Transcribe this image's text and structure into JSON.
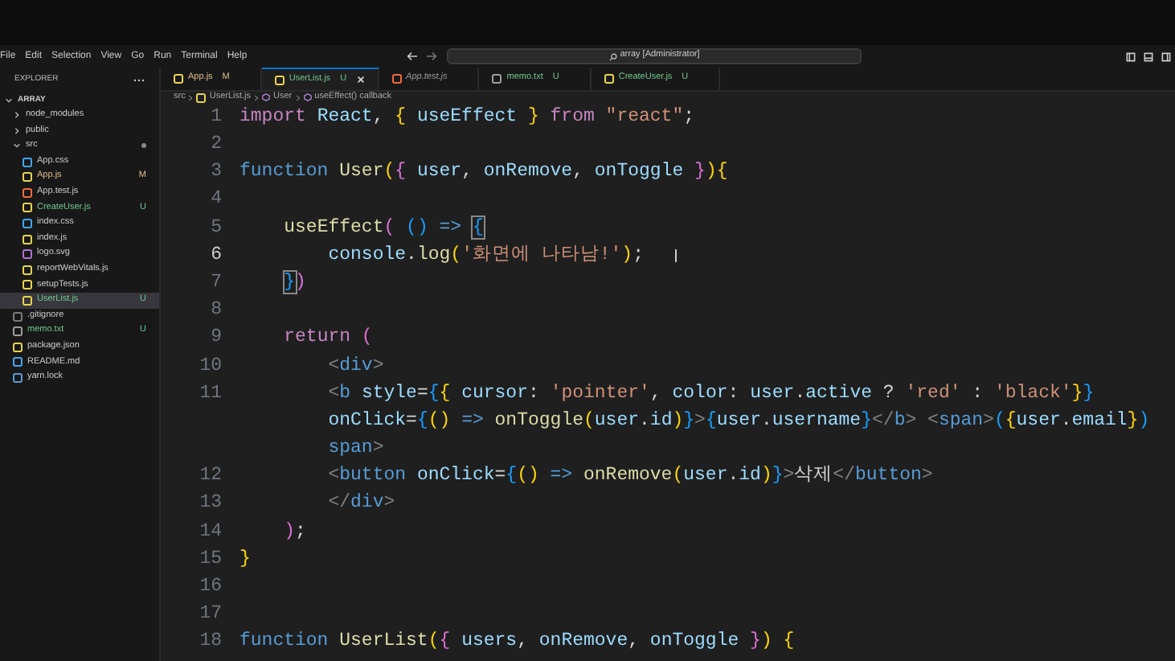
{
  "menu": [
    "File",
    "Edit",
    "Selection",
    "View",
    "Go",
    "Run",
    "Terminal",
    "Help"
  ],
  "command_center": {
    "value": "array [Administrator]"
  },
  "explorer": {
    "title": "EXPLORER",
    "root": {
      "name": "ARRAY",
      "expanded": true,
      "children": [
        {
          "name": "node_modules",
          "kind": "folder",
          "expanded": false,
          "selected": false
        },
        {
          "name": "public",
          "kind": "folder",
          "expanded": false,
          "selected": false
        },
        {
          "name": "src",
          "kind": "folder",
          "expanded": true,
          "selected": false,
          "changes_dot": true,
          "children": [
            {
              "name": "App.css",
              "kind": "css",
              "selected": false
            },
            {
              "name": "App.js",
              "kind": "js",
              "color": "#e2c08d",
              "status": "M",
              "selected": false
            },
            {
              "name": "App.test.js",
              "kind": "test",
              "selected": false
            },
            {
              "name": "CreateUser.js",
              "kind": "js",
              "color": "#73c991",
              "status": "U",
              "selected": false
            },
            {
              "name": "index.css",
              "kind": "css",
              "selected": false
            },
            {
              "name": "index.js",
              "kind": "js",
              "selected": false
            },
            {
              "name": "logo.svg",
              "kind": "svg",
              "selected": false
            },
            {
              "name": "reportWebVitals.js",
              "kind": "js",
              "selected": false
            },
            {
              "name": "setupTests.js",
              "kind": "js",
              "selected": false
            },
            {
              "name": "UserList.js",
              "kind": "js",
              "color": "#73c991",
              "status": "U",
              "selected": true
            }
          ]
        },
        {
          "name": ".gitignore",
          "kind": "git",
          "selected": false
        },
        {
          "name": "memo.txt",
          "kind": "txt",
          "color": "#73c991",
          "status": "U",
          "selected": false
        },
        {
          "name": "package.json",
          "kind": "json",
          "selected": false
        },
        {
          "name": "README.md",
          "kind": "md",
          "selected": false
        },
        {
          "name": "yarn.lock",
          "kind": "yarn",
          "selected": false
        }
      ]
    }
  },
  "tabs": [
    {
      "name": "App.js",
      "kind": "js",
      "color": "#e2c08d",
      "status": "M",
      "selected": false,
      "preview": false
    },
    {
      "name": "UserList.js",
      "kind": "js",
      "color": "#73c991",
      "status": "U",
      "selected": true,
      "preview": false
    },
    {
      "name": "App.test.js",
      "kind": "test",
      "selected": false,
      "preview": true
    },
    {
      "name": "memo.txt",
      "kind": "txt",
      "color": "#73c991",
      "status": "U",
      "selected": false,
      "preview": false
    },
    {
      "name": "CreateUser.js",
      "kind": "js",
      "color": "#73c991",
      "status": "U",
      "selected": false,
      "preview": false
    }
  ],
  "breadcrumb": [
    {
      "text": "src",
      "kind": "folder"
    },
    {
      "text": "UserList.js",
      "kind": "js"
    },
    {
      "text": "User",
      "kind": "symbol"
    },
    {
      "text": "useEffect() callback",
      "kind": "symbol"
    }
  ],
  "editor": {
    "lines": [
      {
        "number": "1",
        "current": false,
        "tokens": [
          {
            "kind": "kw",
            "text": "import "
          },
          {
            "kind": "var",
            "text": "React"
          },
          {
            "kind": "p",
            "text": ", "
          },
          {
            "kind": "b1",
            "text": "{ "
          },
          {
            "kind": "var",
            "text": "useEffect "
          },
          {
            "kind": "b1",
            "text": "} "
          },
          {
            "kind": "kw",
            "text": "from "
          },
          {
            "kind": "str",
            "text": "\"react\""
          },
          {
            "kind": "p",
            "text": ";"
          }
        ]
      },
      {
        "number": "2",
        "current": false
      },
      {
        "number": "3",
        "current": false,
        "tokens": [
          {
            "kind": "st",
            "text": "function "
          },
          {
            "kind": "fn",
            "text": "User"
          },
          {
            "kind": "b1",
            "text": "("
          },
          {
            "kind": "b2",
            "text": "{ "
          },
          {
            "kind": "var",
            "text": "user"
          },
          {
            "kind": "p",
            "text": ", "
          },
          {
            "kind": "var",
            "text": "onRemove"
          },
          {
            "kind": "p",
            "text": ", "
          },
          {
            "kind": "var",
            "text": "onToggle "
          },
          {
            "kind": "b2",
            "text": "}"
          },
          {
            "kind": "b1",
            "text": ")"
          },
          {
            "kind": "b1",
            "text": "{"
          }
        ]
      },
      {
        "number": "4",
        "current": false
      },
      {
        "number": "5",
        "current": false,
        "tokens": [
          {
            "kind": "fn",
            "text": "    useEffect"
          },
          {
            "kind": "b2",
            "text": "( "
          },
          {
            "kind": "b3",
            "text": "() "
          },
          {
            "kind": "st",
            "text": "=> "
          },
          {
            "kind": "b3m",
            "text": "{"
          }
        ]
      },
      {
        "number": "6",
        "current": true,
        "tokens": [
          {
            "kind": "var",
            "text": "        console"
          },
          {
            "kind": "p",
            "text": "."
          },
          {
            "kind": "fn",
            "text": "log"
          },
          {
            "kind": "b1",
            "text": "("
          },
          {
            "kind": "str",
            "text": "'화면에 나타남!'"
          },
          {
            "kind": "b1",
            "text": ")"
          },
          {
            "kind": "p",
            "text": ";"
          }
        ]
      },
      {
        "number": "7",
        "current": false,
        "tokens": [
          {
            "kind": "b3m",
            "text": "    }"
          },
          {
            "kind": "b2",
            "text": ")"
          }
        ]
      },
      {
        "number": "8",
        "current": false
      },
      {
        "number": "9",
        "current": false,
        "tokens": [
          {
            "kind": "kw",
            "text": "    return "
          },
          {
            "kind": "b2",
            "text": "("
          }
        ]
      },
      {
        "number": "10",
        "current": false,
        "tokens": [
          {
            "kind": "tag",
            "text": "        <"
          },
          {
            "kind": "st",
            "text": "div"
          },
          {
            "kind": "tag",
            "text": ">"
          }
        ]
      },
      {
        "number": "11",
        "current": false,
        "tokens": [
          {
            "kind": "tag",
            "text": "        <"
          },
          {
            "kind": "st",
            "text": "b "
          },
          {
            "kind": "var",
            "text": "style"
          },
          {
            "kind": "p",
            "text": "="
          },
          {
            "kind": "b3",
            "text": "{"
          },
          {
            "kind": "b1",
            "text": "{ "
          },
          {
            "kind": "var",
            "text": "cursor"
          },
          {
            "kind": "p",
            "text": ": "
          },
          {
            "kind": "str",
            "text": "'pointer'"
          },
          {
            "kind": "p",
            "text": ", "
          },
          {
            "kind": "var",
            "text": "color"
          },
          {
            "kind": "p",
            "text": ": "
          },
          {
            "kind": "var",
            "text": "user"
          },
          {
            "kind": "p",
            "text": "."
          },
          {
            "kind": "var",
            "text": "active"
          },
          {
            "kind": "p",
            "text": " ? "
          },
          {
            "kind": "str",
            "text": "'red'"
          },
          {
            "kind": "p",
            "text": " : "
          },
          {
            "kind": "str",
            "text": "'black'"
          },
          {
            "kind": "b1",
            "text": "}"
          },
          {
            "kind": "b3",
            "text": "}"
          }
        ]
      },
      {
        "current": false,
        "tokens": [
          {
            "kind": "var",
            "text": "        onClick"
          },
          {
            "kind": "p",
            "text": "="
          },
          {
            "kind": "b3",
            "text": "{"
          },
          {
            "kind": "b1",
            "text": "() "
          },
          {
            "kind": "st",
            "text": "=> "
          },
          {
            "kind": "fn",
            "text": "onToggle"
          },
          {
            "kind": "b1",
            "text": "("
          },
          {
            "kind": "var",
            "text": "user"
          },
          {
            "kind": "p",
            "text": "."
          },
          {
            "kind": "var",
            "text": "id"
          },
          {
            "kind": "b1",
            "text": ")"
          },
          {
            "kind": "b3",
            "text": "}"
          },
          {
            "kind": "tag",
            "text": ">"
          },
          {
            "kind": "b3",
            "text": "{"
          },
          {
            "kind": "var",
            "text": "user"
          },
          {
            "kind": "p",
            "text": "."
          },
          {
            "kind": "var",
            "text": "username"
          },
          {
            "kind": "b3",
            "text": "}"
          },
          {
            "kind": "tag",
            "text": "</"
          },
          {
            "kind": "st",
            "text": "b"
          },
          {
            "kind": "tag",
            "text": "> <"
          },
          {
            "kind": "st",
            "text": "span"
          },
          {
            "kind": "tag",
            "text": ">"
          },
          {
            "kind": "b3",
            "text": "("
          },
          {
            "kind": "b1",
            "text": "{"
          },
          {
            "kind": "var",
            "text": "user"
          },
          {
            "kind": "p",
            "text": "."
          },
          {
            "kind": "var",
            "text": "email"
          },
          {
            "kind": "b1",
            "text": "}"
          },
          {
            "kind": "b3",
            "text": ")"
          }
        ]
      },
      {
        "current": false,
        "tokens": [
          {
            "kind": "st",
            "text": "        span"
          },
          {
            "kind": "tag",
            "text": ">"
          }
        ]
      },
      {
        "number": "12",
        "current": false,
        "tokens": [
          {
            "kind": "tag",
            "text": "        <"
          },
          {
            "kind": "st",
            "text": "button "
          },
          {
            "kind": "var",
            "text": "onClick"
          },
          {
            "kind": "p",
            "text": "="
          },
          {
            "kind": "b3",
            "text": "{"
          },
          {
            "kind": "b1",
            "text": "() "
          },
          {
            "kind": "st",
            "text": "=> "
          },
          {
            "kind": "fn",
            "text": "onRemove"
          },
          {
            "kind": "b1",
            "text": "("
          },
          {
            "kind": "var",
            "text": "user"
          },
          {
            "kind": "p",
            "text": "."
          },
          {
            "kind": "var",
            "text": "id"
          },
          {
            "kind": "b1",
            "text": ")"
          },
          {
            "kind": "b3",
            "text": "}"
          },
          {
            "kind": "tag",
            "text": ">"
          },
          {
            "kind": "p",
            "text": "삭제"
          },
          {
            "kind": "tag",
            "text": "</"
          },
          {
            "kind": "st",
            "text": "button"
          },
          {
            "kind": "tag",
            "text": ">"
          }
        ]
      },
      {
        "number": "13",
        "current": false,
        "tokens": [
          {
            "kind": "tag",
            "text": "        </"
          },
          {
            "kind": "st",
            "text": "div"
          },
          {
            "kind": "tag",
            "text": ">"
          }
        ]
      },
      {
        "number": "14",
        "current": false,
        "tokens": [
          {
            "kind": "b2",
            "text": "    )"
          },
          {
            "kind": "p",
            "text": ";"
          }
        ]
      },
      {
        "number": "15",
        "current": false,
        "tokens": [
          {
            "kind": "b1",
            "text": "}"
          }
        ]
      },
      {
        "number": "16",
        "current": false
      },
      {
        "number": "17",
        "current": false
      },
      {
        "number": "18",
        "current": false,
        "tokens": [
          {
            "kind": "st",
            "text": "function "
          },
          {
            "kind": "fn",
            "text": "UserList"
          },
          {
            "kind": "b1",
            "text": "("
          },
          {
            "kind": "b2",
            "text": "{ "
          },
          {
            "kind": "var",
            "text": "users"
          },
          {
            "kind": "p",
            "text": ", "
          },
          {
            "kind": "var",
            "text": "onRemove"
          },
          {
            "kind": "p",
            "text": ", "
          },
          {
            "kind": "var",
            "text": "onToggle "
          },
          {
            "kind": "b2",
            "text": "}"
          },
          {
            "kind": "b1",
            "text": ") "
          },
          {
            "kind": "b1",
            "text": "{"
          }
        ]
      }
    ]
  }
}
